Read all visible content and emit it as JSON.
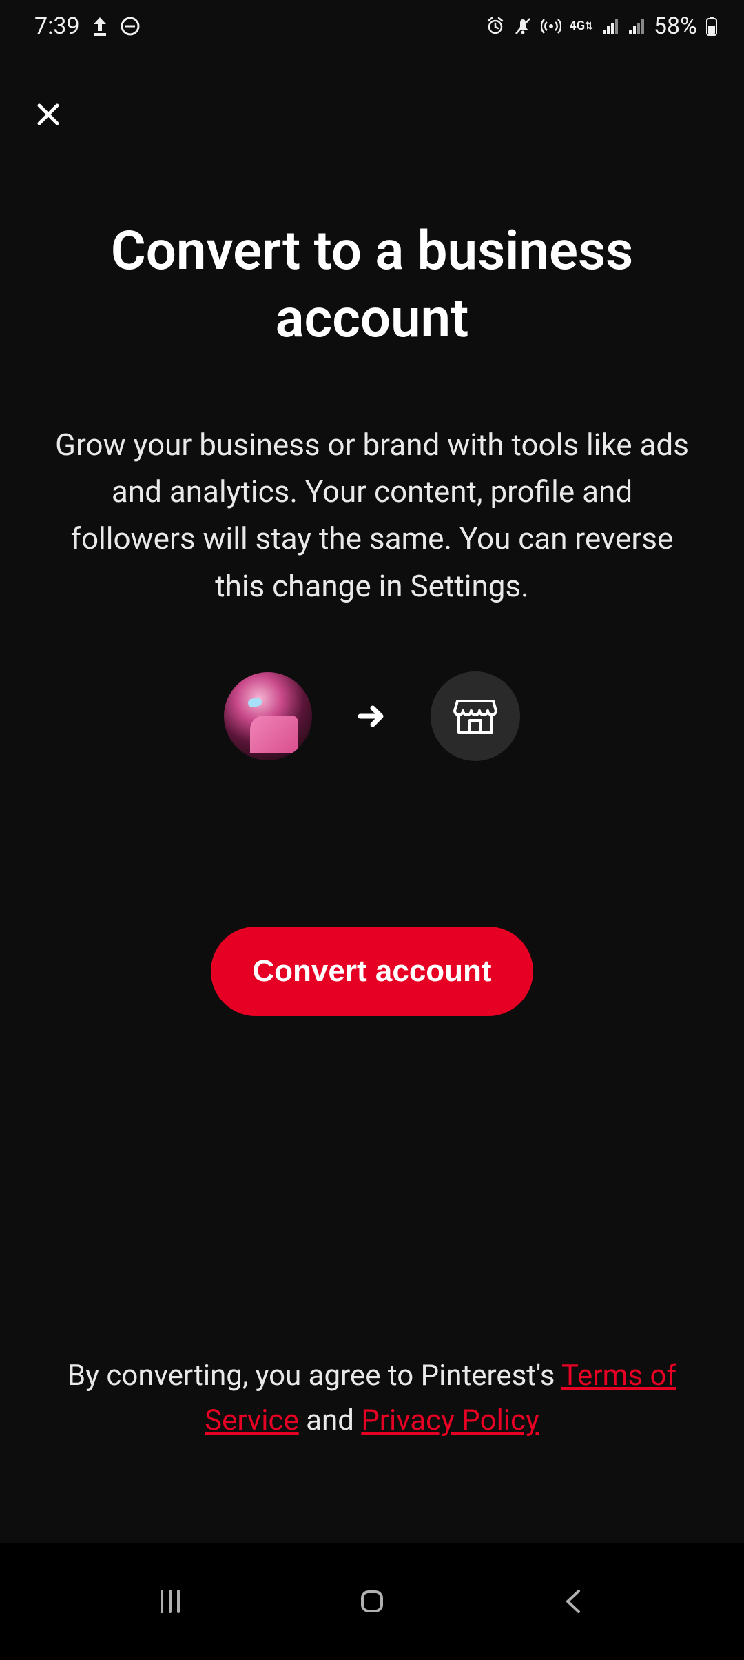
{
  "statusbar": {
    "time": "7:39",
    "battery": "58%"
  },
  "header": {
    "title": "Convert to a business account"
  },
  "body": {
    "subtitle": "Grow your business or brand with tools like ads and analytics. Your content, profile and followers will stay the same. You can reverse this change in Settings."
  },
  "cta": {
    "label": "Convert account"
  },
  "footer": {
    "prefix": "By converting, you agree to Pinterest's ",
    "tos_link": "Terms of Service",
    "and": " and ",
    "privacy_link": "Privacy Policy"
  },
  "colors": {
    "accent": "#e60023",
    "bg": "#0d0d0d"
  }
}
